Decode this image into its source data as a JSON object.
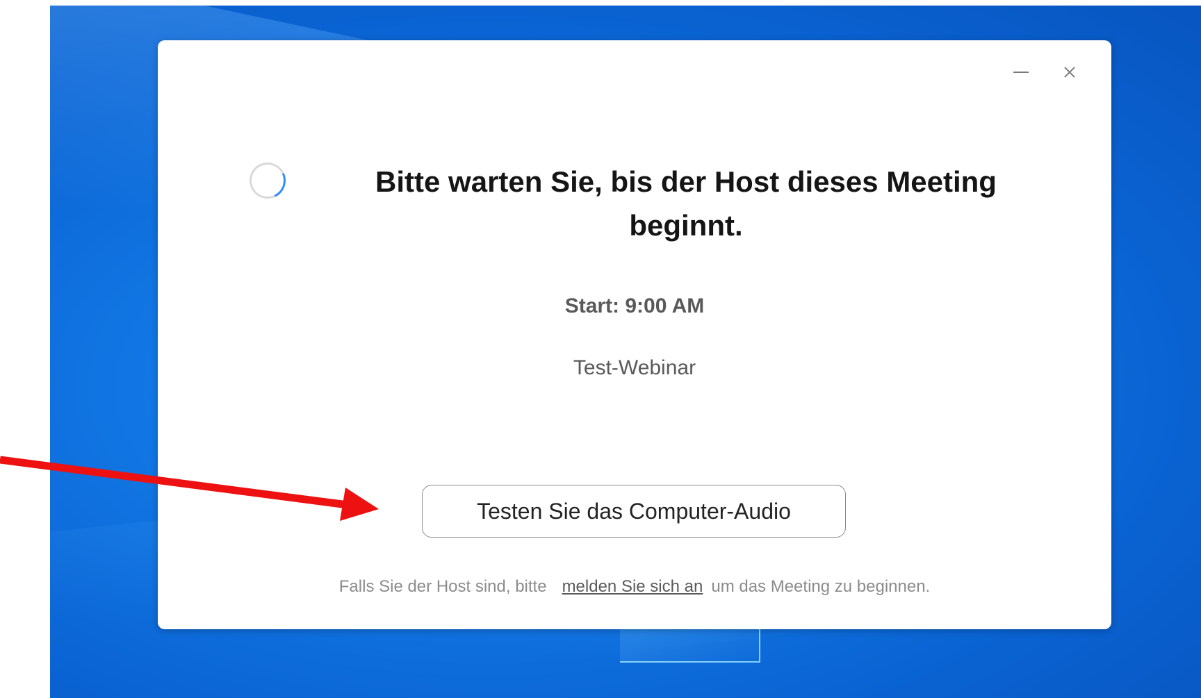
{
  "dialog": {
    "title": "Bitte warten Sie, bis der Host dieses Meeting beginnt.",
    "start_time": "Start: 9:00 AM",
    "meeting_name": "Test-Webinar",
    "test_audio_label": "Testen Sie das Computer-Audio",
    "footer": {
      "prefix": "Falls Sie der Host sind, bitte",
      "link": "melden Sie sich an",
      "suffix": "um das Meeting zu beginnen."
    }
  },
  "window_controls": [
    "minimize-icon",
    "close-icon"
  ],
  "colors": {
    "desktop_blue": "#0a62d1",
    "spinner_accent": "#2d8cff",
    "annotation_red": "#ee1111"
  }
}
